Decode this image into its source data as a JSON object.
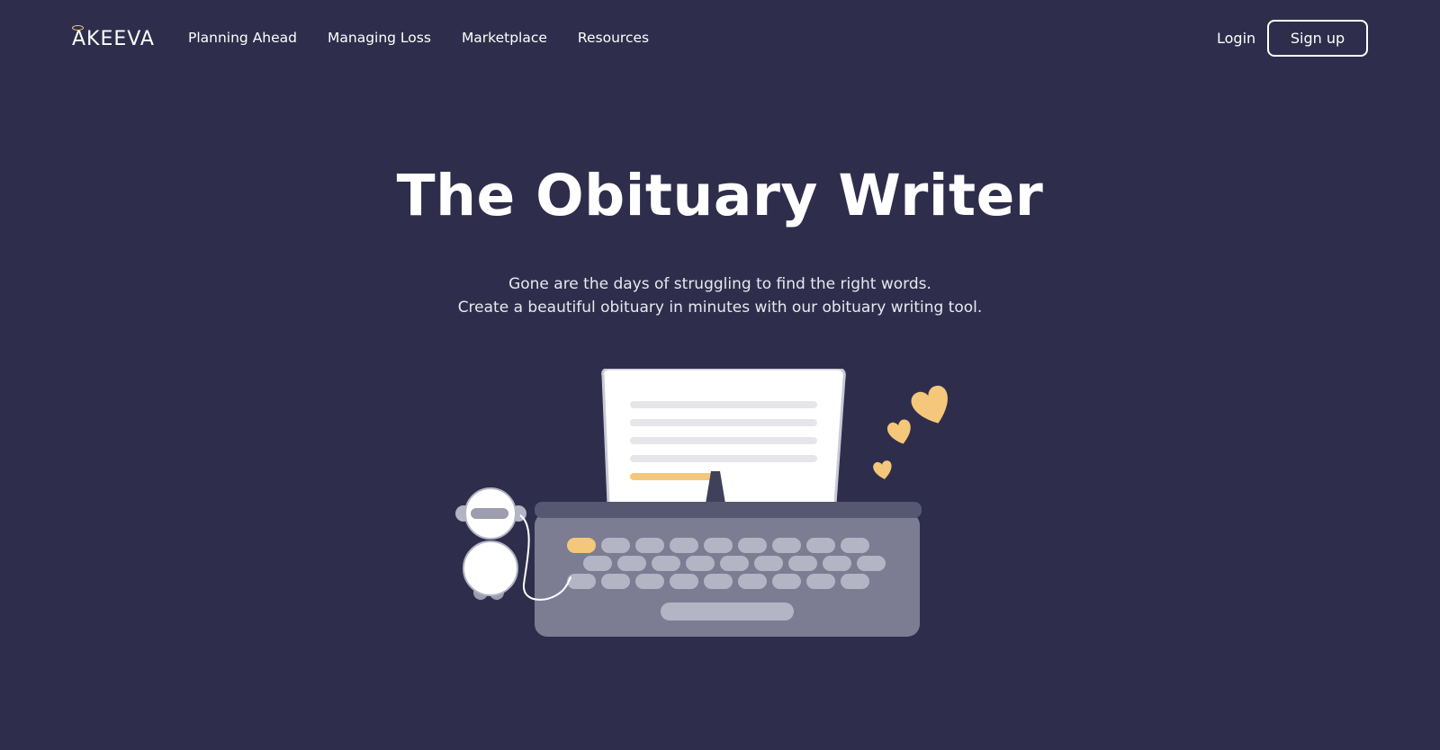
{
  "brand": {
    "logo_text": "AKEEVA"
  },
  "nav": {
    "links": [
      {
        "label": "Planning Ahead"
      },
      {
        "label": "Managing Loss"
      },
      {
        "label": "Marketplace"
      },
      {
        "label": "Resources"
      }
    ],
    "login_label": "Login",
    "signup_label": "Sign up"
  },
  "hero": {
    "title": "The Obituary Writer",
    "subtitle_line1": "Gone are the days of struggling to find the right words.",
    "subtitle_line2": "Create a beautiful obituary in minutes with our obituary writing tool."
  },
  "colors": {
    "background": "#2e2e4c",
    "accent": "#f5c77a",
    "typewriter_body": "#7c7d93",
    "key": "#b4b5c4",
    "paper": "#ffffff"
  }
}
